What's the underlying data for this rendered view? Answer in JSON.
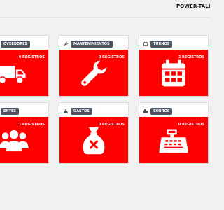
{
  "app": {
    "brand": "POWER-TALLE"
  },
  "colors": {
    "accent": "#ff0000",
    "label_bg": "#4b5563",
    "background": "#f1f1f1"
  },
  "cards": [
    {
      "key": "proveedores",
      "label": "OVEEDORES",
      "count": "0 REGISTROS",
      "header_icon": "none",
      "icon": "truck-icon"
    },
    {
      "key": "mantenimientos",
      "label": "MANTENIMIENTOS",
      "count": "0 REGISTROS",
      "header_icon": "wrench-icon",
      "icon": "wrench-icon"
    },
    {
      "key": "turnos",
      "label": "TURNOS",
      "count": "2 REGISTROS",
      "header_icon": "calendar-icon",
      "icon": "calendar-icon"
    },
    {
      "key": "clientes",
      "label": "ENTES",
      "count": "1 REGISTROS",
      "header_icon": "none",
      "icon": "users-icon"
    },
    {
      "key": "gastos",
      "label": "GASTOS",
      "count": "0 REGISTROS",
      "header_icon": "money-bag-icon",
      "icon": "money-bag-x-icon"
    },
    {
      "key": "cobros",
      "label": "COBROS",
      "count": "0 REGISTROS",
      "header_icon": "cash-register-icon",
      "icon": "cash-register-icon"
    }
  ]
}
